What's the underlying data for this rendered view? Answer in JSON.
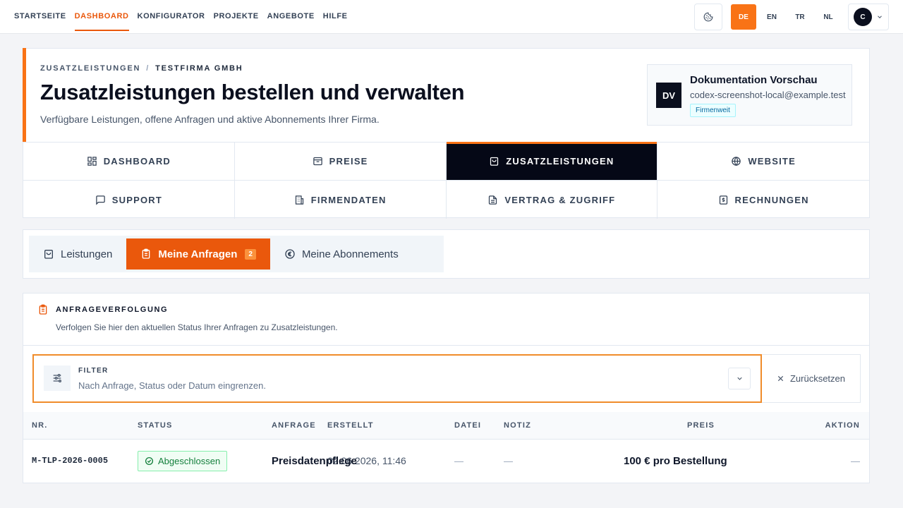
{
  "nav": {
    "items": [
      {
        "label": "STARTSEITE",
        "active": false
      },
      {
        "label": "DASHBOARD",
        "active": true
      },
      {
        "label": "KONFIGURATOR",
        "active": false
      },
      {
        "label": "PROJEKTE",
        "active": false
      },
      {
        "label": "ANGEBOTE",
        "active": false
      },
      {
        "label": "HILFE",
        "active": false
      }
    ],
    "theme_icon": "cookie-icon",
    "languages": [
      "DE",
      "EN",
      "TR",
      "NL"
    ],
    "active_language": "DE",
    "user_initial": "C"
  },
  "header": {
    "breadcrumb": {
      "parent": "ZUSATZLEISTUNGEN",
      "current": "TESTFIRMA GMBH"
    },
    "title": "Zusatzleistungen bestellen und verwalten",
    "subtitle": "Verfügbare Leistungen, offene Anfragen und aktive Abonnements Ihrer Firma.",
    "account": {
      "initials": "DV",
      "name": "Dokumentation Vorschau",
      "email": "codex-screenshot-local@example.test",
      "badge": "Firmenweit"
    }
  },
  "main_tabs": [
    {
      "label": "DASHBOARD",
      "icon": "dashboard-grid-icon",
      "active": false
    },
    {
      "label": "PREISE",
      "icon": "tag-icon",
      "active": false
    },
    {
      "label": "ZUSATZLEISTUNGEN",
      "icon": "shopping-bag-icon",
      "active": true
    },
    {
      "label": "WEBSITE",
      "icon": "globe-icon",
      "active": false
    },
    {
      "label": "SUPPORT",
      "icon": "chat-icon",
      "active": false
    },
    {
      "label": "FIRMENDATEN",
      "icon": "building-icon",
      "active": false
    },
    {
      "label": "VERTRAG & ZUGRIFF",
      "icon": "document-icon",
      "active": false
    },
    {
      "label": "RECHNUNGEN",
      "icon": "invoice-icon",
      "active": false
    }
  ],
  "sub_tabs": [
    {
      "label": "Leistungen",
      "icon": "shopping-bag-icon",
      "active": false,
      "count": ""
    },
    {
      "label": "Meine Anfragen",
      "icon": "clipboard-icon",
      "active": true,
      "count": "2"
    },
    {
      "label": "Meine Abonnements",
      "icon": "euro-icon",
      "active": false,
      "count": ""
    }
  ],
  "requests": {
    "title": "ANFRAGEVERFOLGUNG",
    "subtitle": "Verfolgen Sie hier den aktuellen Status Ihrer Anfragen zu Zusatzleistungen.",
    "filter": {
      "label": "FILTER",
      "description": "Nach Anfrage, Status oder Datum eingrenzen."
    },
    "reset_label": "Zurücksetzen",
    "columns": [
      "NR.",
      "STATUS",
      "ANFRAGE",
      "ERSTELLT",
      "DATEI",
      "NOTIZ",
      "PREIS",
      "AKTION"
    ],
    "rows": [
      {
        "nr": "M-TLP-2026-0005",
        "status": "Abgeschlossen",
        "anfrage": "Preisdatenpflege",
        "erstellt": "02.06.2026, 11:46",
        "datei": "—",
        "notiz": "—",
        "preis": "100 € pro Bestellung",
        "aktion": "—"
      }
    ]
  },
  "colors": {
    "accent": "#ea580c",
    "accent_light": "#f97316",
    "dark": "#050816",
    "success": "#15803d"
  }
}
